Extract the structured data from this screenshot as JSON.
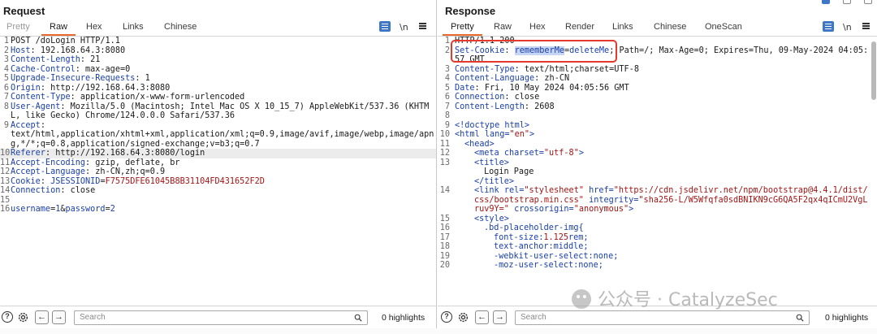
{
  "request": {
    "title": "Request",
    "tabs": [
      "Pretty",
      "Raw",
      "Hex",
      "Links",
      "Chinese"
    ],
    "active_tab": "Raw",
    "wrap_label": "\\n",
    "lines": [
      {
        "n": "1",
        "key": "",
        "val": "POST /doLogin HTTP/1.1"
      },
      {
        "n": "2",
        "key": "Host",
        "val": "192.168.64.3:8080"
      },
      {
        "n": "3",
        "key": "Content-Length",
        "val": "21"
      },
      {
        "n": "4",
        "key": "Cache-Control",
        "val": "max-age=0"
      },
      {
        "n": "5",
        "key": "Upgrade-Insecure-Requests",
        "val": "1"
      },
      {
        "n": "6",
        "key": "Origin",
        "val": "http://192.168.64.3:8080"
      },
      {
        "n": "7",
        "key": "Content-Type",
        "val": "application/x-www-form-urlencoded"
      },
      {
        "n": "8",
        "key": "User-Agent",
        "val": "Mozilla/5.0 (Macintosh; Intel Mac OS X 10_15_7) AppleWebKit/537.36 (KHTML, like Gecko) Chrome/124.0.0.0 Safari/537.36"
      },
      {
        "n": "9",
        "key": "Accept",
        "val": "text/html,application/xhtml+xml,application/xml;q=0.9,image/avif,image/webp,image/apng,*/*;q=0.8,application/signed-exchange;v=b3;q=0.7",
        "break": true
      },
      {
        "n": "10",
        "key": "Referer",
        "val": "http://192.168.64.3:8080/login",
        "highlight": true
      },
      {
        "n": "11",
        "key": "Accept-Encoding",
        "val": "gzip, deflate, br"
      },
      {
        "n": "12",
        "key": "Accept-Language",
        "val": "zh-CN,zh;q=0.9"
      },
      {
        "n": "13",
        "key": "Cookie",
        "val": "",
        "cookie_name": "JSESSIONID",
        "cookie_value": "F7575DFE61045B8B31104FD431652F2D"
      },
      {
        "n": "14",
        "key": "Connection",
        "val": "close"
      },
      {
        "n": "15",
        "key": "",
        "val": ""
      },
      {
        "n": "16",
        "key": "",
        "val": "",
        "body": [
          [
            "username",
            "1"
          ],
          [
            "password",
            "2"
          ]
        ]
      }
    ],
    "search_placeholder": "Search",
    "highlights": "0 highlights"
  },
  "response": {
    "title": "Response",
    "tabs": [
      "Pretty",
      "Raw",
      "Hex",
      "Render",
      "Links",
      "Chinese",
      "OneScan"
    ],
    "active_tab": "Pretty",
    "wrap_label": "\\n",
    "lines": [
      {
        "n": "1",
        "html": "HTTP/1.1 200"
      },
      {
        "n": "2",
        "set_cookie": true,
        "key": "Set-Cookie",
        "cookie_name": "rememberMe",
        "cookie_value": "deleteMe",
        "rest": "; Path=/; Max-Age=0; Expires=Thu, 09-May-2024 04:05:57 GMT"
      },
      {
        "n": "3",
        "key": "Content-Type",
        "val": "text/html;charset=UTF-8"
      },
      {
        "n": "4",
        "key": "Content-Language",
        "val": "zh-CN"
      },
      {
        "n": "5",
        "key": "Date",
        "val": "Fri, 10 May 2024 04:05:56 GMT"
      },
      {
        "n": "6",
        "key": "Connection",
        "val": "close"
      },
      {
        "n": "7",
        "key": "Content-Length",
        "val": "2608"
      },
      {
        "n": "8",
        "html": ""
      },
      {
        "n": "9",
        "markup": [
          [
            "t",
            "<!doctype html>"
          ]
        ]
      },
      {
        "n": "10",
        "markup": [
          [
            "t",
            "<html "
          ],
          [
            "a",
            "lang"
          ],
          [
            "t",
            "="
          ],
          [
            "v",
            "\"en\""
          ],
          [
            "t",
            ">"
          ]
        ]
      },
      {
        "n": "11",
        "indent": 1,
        "markup": [
          [
            "t",
            "<head>"
          ]
        ]
      },
      {
        "n": "12",
        "indent": 2,
        "markup": [
          [
            "t",
            "<meta "
          ],
          [
            "a",
            "charset"
          ],
          [
            "t",
            "="
          ],
          [
            "v",
            "\"utf-8\""
          ],
          [
            "t",
            ">"
          ]
        ]
      },
      {
        "n": "13",
        "indent": 2,
        "markup": [
          [
            "t",
            "<title>"
          ]
        ]
      },
      {
        "n": "",
        "indent": 3,
        "markup": [
          [
            "x",
            "Login Page"
          ]
        ]
      },
      {
        "n": "",
        "indent": 2,
        "markup": [
          [
            "t",
            "</title>"
          ]
        ]
      },
      {
        "n": "14",
        "indent": 2,
        "markup": [
          [
            "t",
            "<link "
          ],
          [
            "a",
            "rel"
          ],
          [
            "t",
            "="
          ],
          [
            "v",
            "\"stylesheet\""
          ],
          [
            "t",
            " "
          ],
          [
            "a",
            "href"
          ],
          [
            "t",
            "="
          ],
          [
            "v",
            "\"https://cdn.jsdelivr.net/npm/bootstrap@4.4.1/dist/css/bootstrap.min.css\""
          ],
          [
            "t",
            " "
          ],
          [
            "a",
            "integrity"
          ],
          [
            "t",
            "="
          ],
          [
            "v",
            "\"sha256-L/W5Wfqfa0sdBNIKN9cG6QA5F2qx4qICmU2VgLruv9Y=\""
          ],
          [
            "t",
            " "
          ],
          [
            "a",
            "crossorigin"
          ],
          [
            "t",
            "="
          ],
          [
            "v",
            "\"anonymous\""
          ],
          [
            "t",
            ">"
          ]
        ]
      },
      {
        "n": "15",
        "indent": 2,
        "markup": [
          [
            "t",
            "<style>"
          ]
        ]
      },
      {
        "n": "16",
        "indent": 3,
        "markup": [
          [
            "s",
            ".bd-placeholder-img{"
          ]
        ]
      },
      {
        "n": "17",
        "indent": 4,
        "markup": [
          [
            "p",
            "font-size:"
          ],
          [
            "q",
            "1.125"
          ],
          [
            "p",
            "rem;"
          ]
        ]
      },
      {
        "n": "18",
        "indent": 4,
        "markup": [
          [
            "p",
            "text-anchor:middle;"
          ]
        ]
      },
      {
        "n": "19",
        "indent": 4,
        "markup": [
          [
            "p",
            "-webkit-user-select:none;"
          ]
        ]
      },
      {
        "n": "20",
        "indent": 4,
        "markup": [
          [
            "p",
            "-moz-user-select:none;"
          ]
        ]
      }
    ],
    "search_placeholder": "Search",
    "highlights": "0 highlights"
  },
  "watermark": "公众号 · CatalyzeSec",
  "colors": {
    "accent_tab": "#e8682e",
    "header_key": "#1a3fa8",
    "red_box": "#e23b2e",
    "cookie_value": "#a31515"
  }
}
